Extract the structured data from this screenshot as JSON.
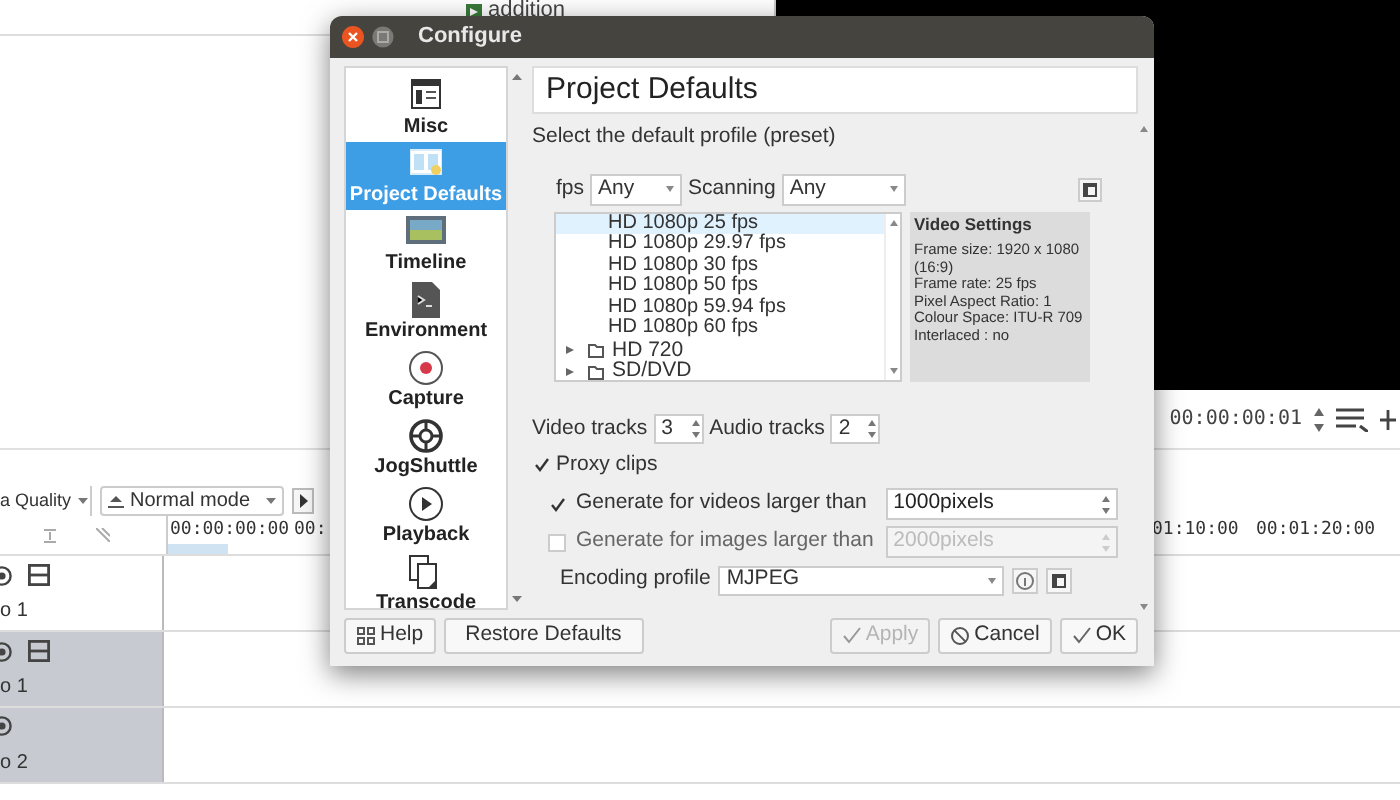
{
  "background": {
    "clip_label": "addition",
    "monitor_toolbar": {
      "timecode": "00:00:00:01"
    },
    "timeline_toolbar": {
      "quality": "a Quality",
      "mode": "Normal mode"
    },
    "ruler": [
      "00:00:00:00",
      "00:",
      "01:10:00",
      "00:01:20:00"
    ],
    "tracks": [
      {
        "name": "o 1",
        "kind": "video",
        "selected": false
      },
      {
        "name": "o 1",
        "kind": "video",
        "selected": true
      },
      {
        "name": "o 2",
        "kind": "audio",
        "selected": true
      }
    ]
  },
  "dialog": {
    "title": "Configure",
    "sidebar": [
      {
        "label": "Misc",
        "selected": false
      },
      {
        "label": "Project Defaults",
        "selected": true
      },
      {
        "label": "Timeline",
        "selected": false
      },
      {
        "label": "Environment",
        "selected": false
      },
      {
        "label": "Capture",
        "selected": false
      },
      {
        "label": "JogShuttle",
        "selected": false
      },
      {
        "label": "Playback",
        "selected": false
      },
      {
        "label": "Transcode",
        "selected": false
      }
    ],
    "page_title": "Project Defaults",
    "prompt": "Select the default profile (preset)",
    "fps": {
      "label": "fps",
      "value": "Any"
    },
    "scanning": {
      "label": "Scanning",
      "value": "Any"
    },
    "profiles": [
      {
        "label": "HD 1080p 25 fps",
        "kind": "profile",
        "selected": true
      },
      {
        "label": "HD 1080p 29.97 fps",
        "kind": "profile",
        "selected": false
      },
      {
        "label": "HD 1080p 30 fps",
        "kind": "profile",
        "selected": false
      },
      {
        "label": "HD 1080p 50 fps",
        "kind": "profile",
        "selected": false
      },
      {
        "label": "HD 1080p 59.94 fps",
        "kind": "profile",
        "selected": false
      },
      {
        "label": "HD 1080p 60 fps",
        "kind": "profile",
        "selected": false
      },
      {
        "label": "HD 720",
        "kind": "folder",
        "expanded": false,
        "selected": false
      },
      {
        "label": "SD/DVD",
        "kind": "folder",
        "expanded": false,
        "selected": false
      }
    ],
    "video_settings": {
      "heading": "Video Settings",
      "lines": [
        "Frame size: 1920 x 1080 (16:9)",
        "Frame rate: 25 fps",
        "Pixel Aspect Ratio: 1",
        "Colour Space: ITU-R 709",
        "Interlaced : no"
      ]
    },
    "video_tracks": {
      "label": "Video tracks",
      "value": "3"
    },
    "audio_tracks": {
      "label": "Audio tracks",
      "value": "2"
    },
    "proxy_clips": {
      "label": "Proxy clips",
      "checked": true
    },
    "proxy_options": [
      {
        "label": "Generate for videos larger than",
        "checked": true,
        "disabled": false,
        "value": "1000pixels"
      },
      {
        "label": "Generate for images larger than",
        "checked": false,
        "disabled": true,
        "value": "2000pixels"
      }
    ],
    "encoding_profile": {
      "label": "Encoding profile",
      "value": "MJPEG"
    },
    "buttons": [
      {
        "label": "Help",
        "kind": "help",
        "disabled": false
      },
      {
        "label": "Restore Defaults",
        "kind": "plain",
        "disabled": false
      },
      {
        "label": "Apply",
        "kind": "apply",
        "disabled": true
      },
      {
        "label": "Cancel",
        "kind": "cancel",
        "disabled": false
      },
      {
        "label": "OK",
        "kind": "ok",
        "disabled": false
      }
    ]
  }
}
